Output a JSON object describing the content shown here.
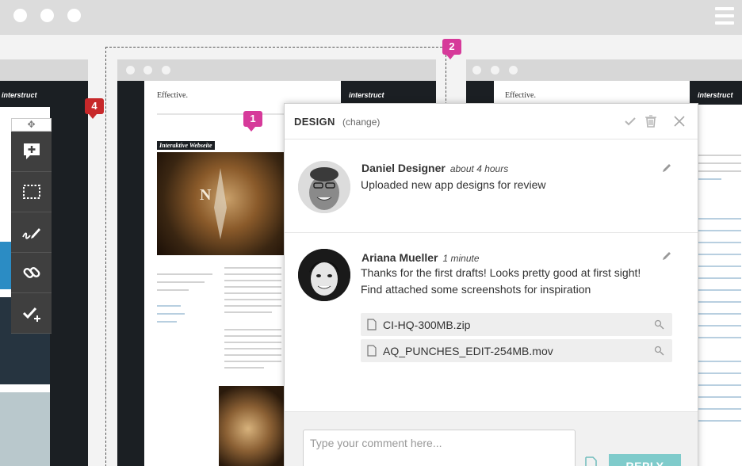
{
  "app": {
    "window_dots": 3,
    "menu_icon": "hamburger-menu-icon"
  },
  "markers": {
    "m1": "1",
    "m2": "2",
    "m4": "4"
  },
  "mock_site": {
    "logo_text": "Effective.",
    "brand": "interstruct",
    "hero_label": "Interaktive Webseite"
  },
  "panel": {
    "title": "DESIGN",
    "change_link": "(change)",
    "comments": [
      {
        "author": "Daniel Designer",
        "time": "about 4 hours",
        "text": "Uploaded new app designs for review",
        "attachments": []
      },
      {
        "author": "Ariana Mueller",
        "time": "1 minute",
        "text_lines": [
          "Thanks for the first drafts! Looks pretty good at first sight!",
          "Find attached some screenshots for inspiration"
        ],
        "attachments": [
          {
            "name": "CI-HQ-300MB.zip"
          },
          {
            "name": "AQ_PUNCHES_EDIT-254MB.mov"
          }
        ]
      }
    ],
    "comment_placeholder": "Type your comment here...",
    "reply_label": "REPLY"
  },
  "colors": {
    "accent_teal": "#7fcbcb",
    "marker_pink": "#d63a9a",
    "marker_red": "#c7282a",
    "tool_dark": "#3f3f3f"
  }
}
